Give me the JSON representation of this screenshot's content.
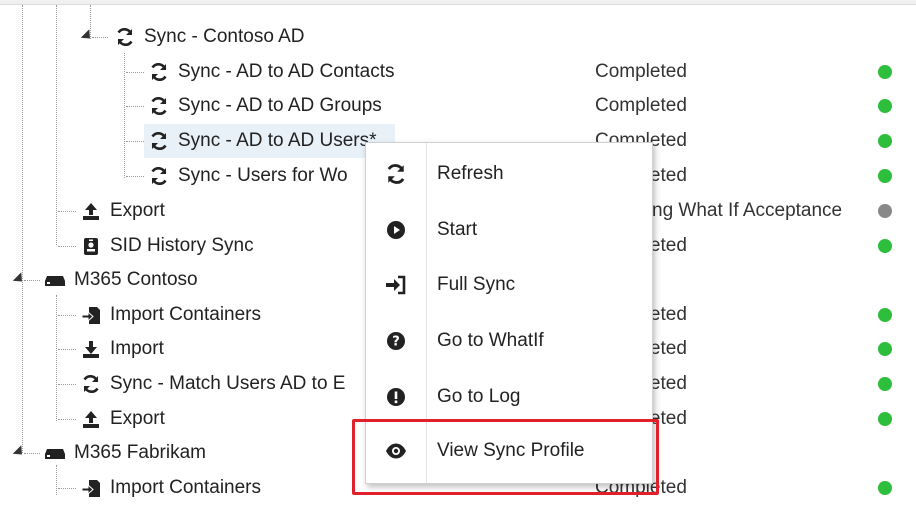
{
  "tree": {
    "rows": [
      {
        "label": "Sync - Contoso AD",
        "status": "",
        "dot": "",
        "icon": "sync-icon"
      },
      {
        "label": "Sync - AD to AD Contacts",
        "status": "Completed",
        "dot": "green",
        "icon": "sync-icon"
      },
      {
        "label": "Sync - AD to AD Groups",
        "status": "Completed",
        "dot": "green",
        "icon": "sync-icon"
      },
      {
        "label": "Sync - AD to AD Users*",
        "status": "Completed",
        "dot": "green",
        "icon": "sync-icon",
        "selected": true
      },
      {
        "label": "Sync - Users for Wo",
        "status": "Completed",
        "dot": "green",
        "icon": "sync-icon"
      },
      {
        "label": "Export",
        "status": "ng What If Acceptance",
        "dot": "gray",
        "icon": "upload-icon"
      },
      {
        "label": "SID History Sync",
        "status": "Completed",
        "dot": "green",
        "icon": "id-badge-icon"
      },
      {
        "label": "M365 Contoso",
        "status": "",
        "dot": "",
        "icon": "server-icon"
      },
      {
        "label": "Import Containers",
        "status": "Completed",
        "dot": "green",
        "icon": "import-containers-icon"
      },
      {
        "label": "Import",
        "status": "Completed",
        "dot": "green",
        "icon": "download-icon"
      },
      {
        "label": "Sync - Match Users AD to E",
        "status": "Completed",
        "dot": "green",
        "icon": "sync-icon"
      },
      {
        "label": "Export",
        "status": "Completed",
        "dot": "green",
        "icon": "upload-icon"
      },
      {
        "label": "M365 Fabrikam",
        "status": "",
        "dot": "",
        "icon": "server-icon"
      },
      {
        "label": "Import Containers",
        "status": "Completed",
        "dot": "green",
        "icon": "import-containers-icon"
      }
    ]
  },
  "context_menu": {
    "items": [
      {
        "label": "Refresh",
        "icon": "refresh-icon"
      },
      {
        "label": "Start",
        "icon": "play-icon"
      },
      {
        "label": "Full Sync",
        "icon": "sign-in-icon"
      },
      {
        "label": "Go to WhatIf",
        "icon": "question-icon"
      },
      {
        "label": "Go to Log",
        "icon": "exclamation-icon"
      },
      {
        "label": "View Sync Profile",
        "icon": "eye-icon"
      }
    ]
  },
  "colors": {
    "status_green": "#2dbe3c",
    "status_gray": "#888888",
    "highlight_red": "#e0212b",
    "selection": "#e8f0f8"
  }
}
